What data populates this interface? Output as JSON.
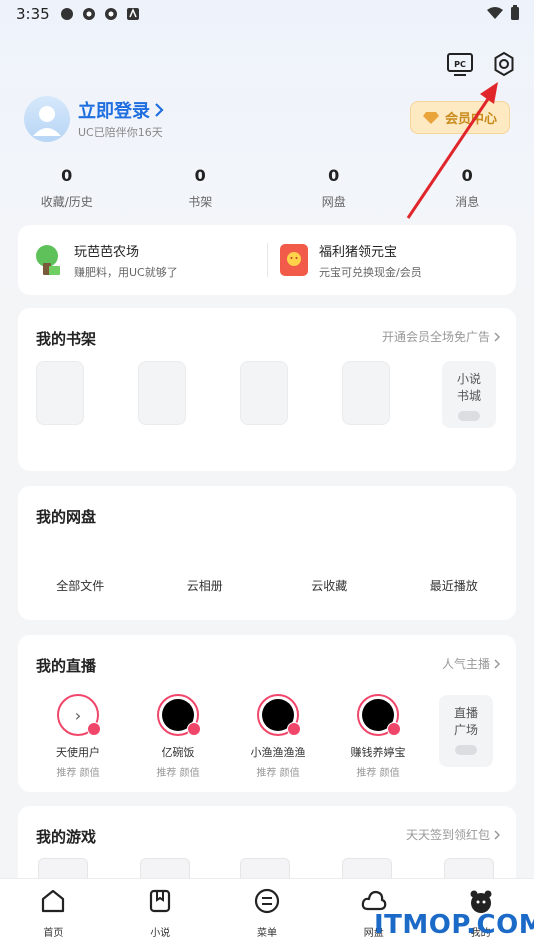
{
  "status_bar": {
    "time": "3:35"
  },
  "profile": {
    "login": "立即登录",
    "subtitle": "UC已陪伴你16天",
    "vip": "会员中心"
  },
  "stats": [
    {
      "value": "0",
      "label": "收藏/历史"
    },
    {
      "value": "0",
      "label": "书架"
    },
    {
      "value": "0",
      "label": "网盘"
    },
    {
      "value": "0",
      "label": "消息"
    }
  ],
  "promos": [
    {
      "title": "玩芭芭农场",
      "sub": "赚肥料，用UC就够了"
    },
    {
      "title": "福利猪领元宝",
      "sub": "元宝可兑换现金/会员"
    }
  ],
  "shelf": {
    "title": "我的书架",
    "link": "开通会员全场免广告",
    "side_line1": "小说",
    "side_line2": "书城"
  },
  "disk": {
    "title": "我的网盘",
    "items": [
      "全部文件",
      "云相册",
      "云收藏",
      "最近播放"
    ]
  },
  "live": {
    "title": "我的直播",
    "link": "人气主播",
    "people": [
      {
        "name": "天使用户",
        "tag": "推荐 颜值"
      },
      {
        "name": "亿碗饭",
        "tag": "推荐 颜值"
      },
      {
        "name": "小渔渔渔渔",
        "tag": "推荐 颜值"
      },
      {
        "name": "赚钱养婷宝",
        "tag": "推荐 颜值"
      }
    ],
    "side_line1": "直播",
    "side_line2": "广场"
  },
  "games": {
    "title": "我的游戏",
    "link": "天天签到领红包"
  },
  "nav": [
    {
      "label": "首页"
    },
    {
      "label": "小说"
    },
    {
      "label": "菜单"
    },
    {
      "label": "网盘"
    },
    {
      "label": "我的"
    }
  ],
  "watermark": "ITMOP.COM",
  "colors": {
    "accent": "#1f6fe0",
    "live": "#f0466a",
    "arrow": "#e0262b",
    "vip": "#c98a1c"
  }
}
